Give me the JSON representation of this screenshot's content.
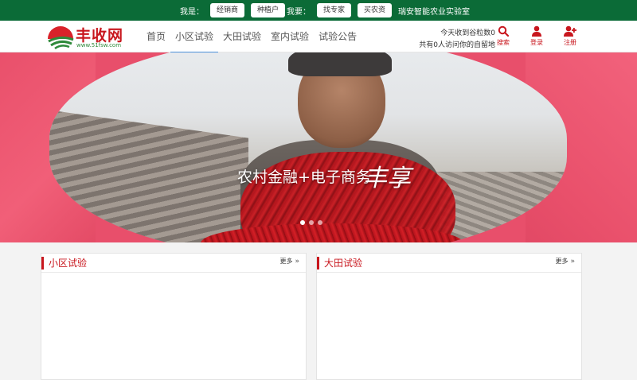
{
  "topbar": {
    "i_am_label": "我是：",
    "i_am_buttons": [
      "经销商",
      "种植户"
    ],
    "i_want_label": "我要：",
    "i_want_buttons": [
      "找专家",
      "买农资"
    ],
    "lab_link": "瑞安智能农业实验室"
  },
  "header": {
    "logo": {
      "brand": "丰收网",
      "url": "www.51fsw.com"
    },
    "nav": [
      "首页",
      "小区试验",
      "大田试验",
      "室内试验",
      "试验公告"
    ],
    "active_nav": "小区试验",
    "stats": {
      "line1": "今天收到谷粒数0",
      "line2": "共有0人访问你的自留地"
    },
    "actions": [
      {
        "label": "搜索",
        "icon": "search-icon"
      },
      {
        "label": "登录",
        "icon": "user-icon"
      },
      {
        "label": "注册",
        "icon": "user-plus-icon"
      }
    ]
  },
  "banner": {
    "slogan": "农村金融+电子商务",
    "calligraphy": "丰享",
    "slides": 3,
    "active_slide": 1
  },
  "panels": [
    {
      "title": "小区试验",
      "more": "更多"
    },
    {
      "title": "大田试验",
      "more": "更多"
    }
  ],
  "colors": {
    "topbar": "#0b6b37",
    "accent": "#c8161d",
    "nav_underline": "#4a90d9"
  }
}
